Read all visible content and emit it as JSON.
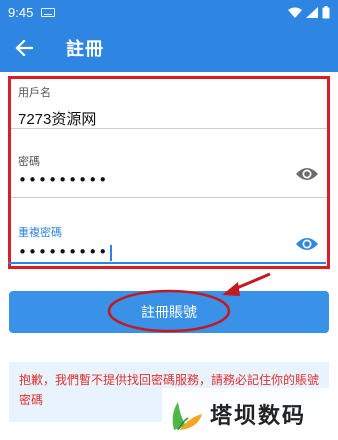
{
  "status": {
    "time": "9:45"
  },
  "app_bar": {
    "title": "註冊"
  },
  "form": {
    "username": {
      "label": "用戶名",
      "value": "7273资源网"
    },
    "password": {
      "label": "密碼",
      "value": "•••••••••"
    },
    "confirm_password": {
      "label": "重複密碼",
      "value": "•••••••••"
    }
  },
  "register_button": {
    "label": "註冊賬號"
  },
  "notice": {
    "text": "抱歉，我們暫不提供找回密碼服務，請務必記住你的賬號密碼"
  },
  "watermark": {
    "text": "塔坝数码"
  },
  "colors": {
    "primary": "#2f86e2",
    "highlight_box": "#d81e28",
    "notice_text": "#e0302e",
    "notice_bg": "#e9f3fd"
  }
}
